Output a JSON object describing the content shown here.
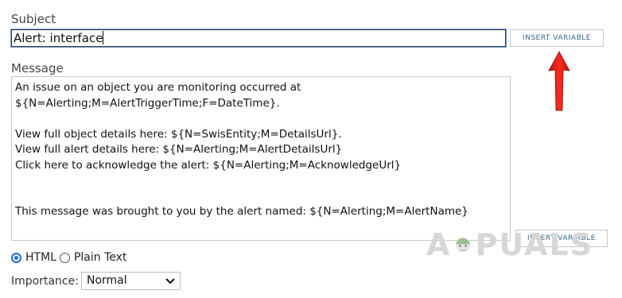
{
  "subject": {
    "label": "Subject",
    "value": "Alert: interface"
  },
  "insert_variable_label": "INSERT VARIABLE",
  "message": {
    "label": "Message",
    "body": "An issue on an object you are monitoring occurred at\n${N=Alerting;M=AlertTriggerTime;F=DateTime}.\n\nView full object details here: ${N=SwisEntity;M=DetailsUrl}.\nView full alert details here: ${N=Alerting;M=AlertDetailsUrl}\nClick here to acknowledge the alert: ${N=Alerting;M=AcknowledgeUrl}\n\n\nThis message was brought to you by the alert named: ${N=Alerting;M=AlertName}"
  },
  "format": {
    "options": [
      "HTML",
      "Plain Text"
    ],
    "selected": "HTML"
  },
  "importance": {
    "label": "Importance:",
    "value": "Normal"
  },
  "watermark": {
    "text_left": "A",
    "text_right": "PUALS"
  },
  "colors": {
    "accent": "#1a6fd1",
    "arrow": "#e0201a",
    "button_text": "#35698f"
  }
}
